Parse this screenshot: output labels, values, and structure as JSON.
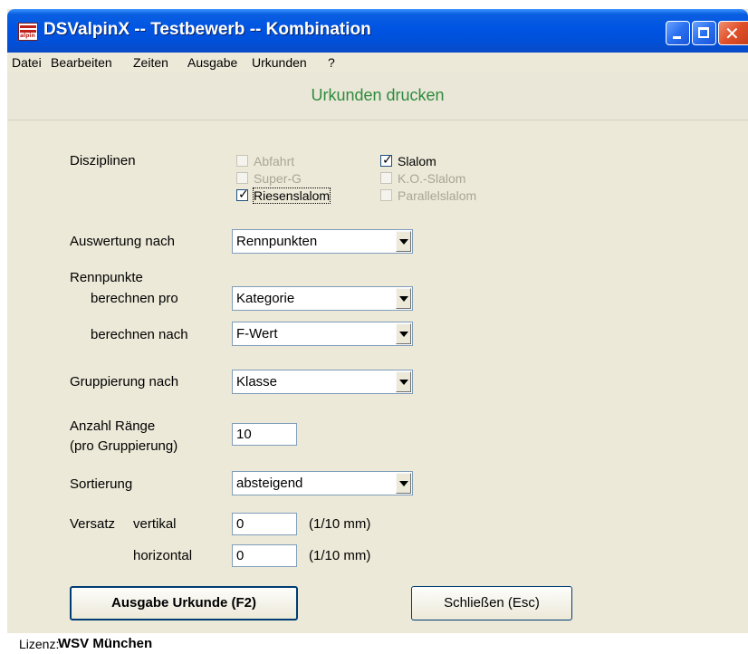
{
  "window": {
    "title": "DSValpinX -- Testbewerb -- Kombination",
    "app_icon_label": "alpin"
  },
  "menu": [
    {
      "label": "Datei"
    },
    {
      "label": "Bearbeiten"
    },
    {
      "label": "Zeiten"
    },
    {
      "label": "Ausgabe"
    },
    {
      "label": "Urkunden"
    },
    {
      "label": "?"
    }
  ],
  "screen_title": "Urkunden drucken",
  "form": {
    "disziplinen": {
      "label": "Disziplinen",
      "options": [
        {
          "label": "Abfahrt",
          "checked": false,
          "enabled": false
        },
        {
          "label": "Super-G",
          "checked": false,
          "enabled": false
        },
        {
          "label": "Riesenslalom",
          "checked": true,
          "enabled": true
        },
        {
          "label": "Slalom",
          "checked": true,
          "enabled": true
        },
        {
          "label": "K.O.-Slalom",
          "checked": false,
          "enabled": false
        },
        {
          "label": "Parallelslalom",
          "checked": false,
          "enabled": false
        }
      ]
    },
    "auswertung": {
      "label": "Auswertung nach",
      "value": "Rennpunkten"
    },
    "rennpunkte": {
      "label": "Rennpunkte",
      "pro_label": "berechnen pro",
      "pro_value": "Kategorie",
      "nach_label": "berechnen nach",
      "nach_value": "F-Wert"
    },
    "gruppierung": {
      "label": "Gruppierung nach",
      "value": "Klasse"
    },
    "anzahl": {
      "label_line1": "Anzahl Ränge",
      "label_line2": "(pro Gruppierung)",
      "value": "10"
    },
    "sortierung": {
      "label": "Sortierung",
      "value": "absteigend"
    },
    "versatz": {
      "label": "Versatz",
      "vertikal_label": "vertikal",
      "vertikal_value": "0",
      "horizontal_label": "horizontal",
      "horizontal_value": "0",
      "unit": "(1/10 mm)"
    }
  },
  "buttons": {
    "print": "Ausgabe Urkunde (F2)",
    "close": "Schließen (Esc)"
  },
  "status": {
    "label": "Lizenz:",
    "value": "WSV München"
  },
  "colors": {
    "title_green": "#2e8b3c",
    "titlebar_blue": "#0054e3",
    "dialog_bg": "#ece9d8"
  }
}
